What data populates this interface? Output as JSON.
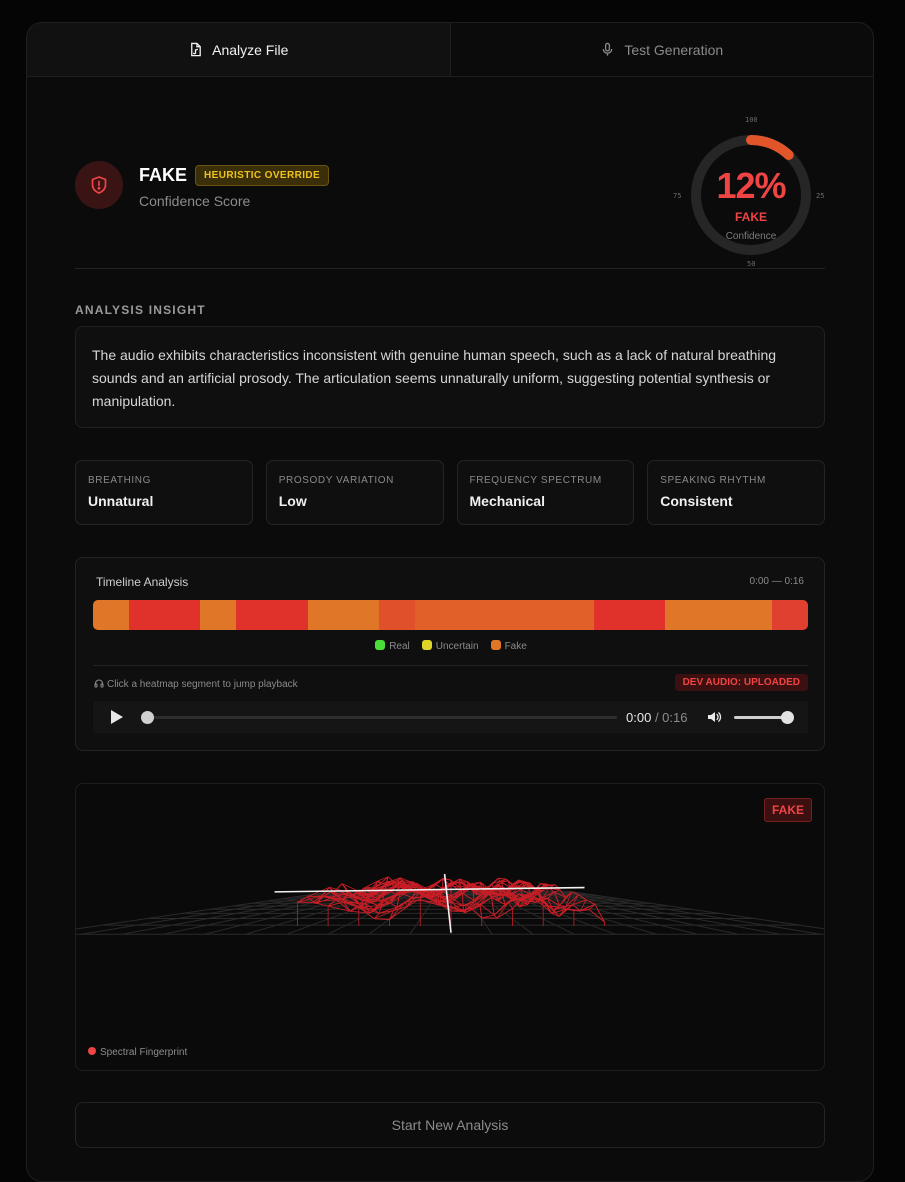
{
  "tabs": [
    {
      "label": "Analyze File",
      "icon": "file-audio-icon",
      "active": true
    },
    {
      "label": "Test Generation",
      "icon": "microphone-icon",
      "active": false
    }
  ],
  "verdict": {
    "label": "FAKE",
    "badge": "HEURISTIC OVERRIDE",
    "subtitle": "Confidence Score",
    "icon": "shield-alert-icon"
  },
  "gauge": {
    "percent_text": "12%",
    "value": 12,
    "verdict": "FAKE",
    "caption": "Confidence",
    "ticks": {
      "top": "100",
      "right": "25",
      "bottom": "50",
      "left": "75"
    },
    "accent": "#ef4444"
  },
  "insight": {
    "label": "ANALYSIS INSIGHT",
    "text": "The audio exhibits characteristics inconsistent with genuine human speech, such as a lack of natural breathing sounds and an artificial prosody. The articulation seems unnaturally uniform, suggesting potential synthesis or manipulation."
  },
  "metrics": [
    {
      "key": "BREATHING",
      "value": "Unnatural"
    },
    {
      "key": "PROSODY VARIATION",
      "value": "Low"
    },
    {
      "key": "FREQUENCY SPECTRUM",
      "value": "Mechanical"
    },
    {
      "key": "SPEAKING RHYTHM",
      "value": "Consistent"
    }
  ],
  "timeline": {
    "title": "Timeline Analysis",
    "range": "0:00 — 0:16",
    "segments": [
      "#e07628",
      "#e0312b",
      "#e0312b",
      "#e07628",
      "#e0312b",
      "#e0312b",
      "#e07628",
      "#e07628",
      "#e0502b",
      "#e06028",
      "#e06028",
      "#e06028",
      "#e06028",
      "#e06028",
      "#e0312b",
      "#e0312b",
      "#e07628",
      "#e07628",
      "#e07628",
      "#e04030"
    ],
    "legend": [
      {
        "label": "Real",
        "color": "#4ade3a"
      },
      {
        "label": "Uncertain",
        "color": "#e0d42a"
      },
      {
        "label": "Fake",
        "color": "#e07628"
      }
    ],
    "hint": "Click a heatmap segment to jump playback",
    "dev_badge": "DEV AUDIO: UPLOADED",
    "player": {
      "current": "0:00",
      "duration": "/ 0:16",
      "progress": 0,
      "volume": 0.85
    }
  },
  "visualization": {
    "tag": "FAKE",
    "legend": "Spectral Fingerprint",
    "mesh_color": "#c81e26"
  },
  "actions": {
    "new_analysis": "Start New Analysis"
  }
}
